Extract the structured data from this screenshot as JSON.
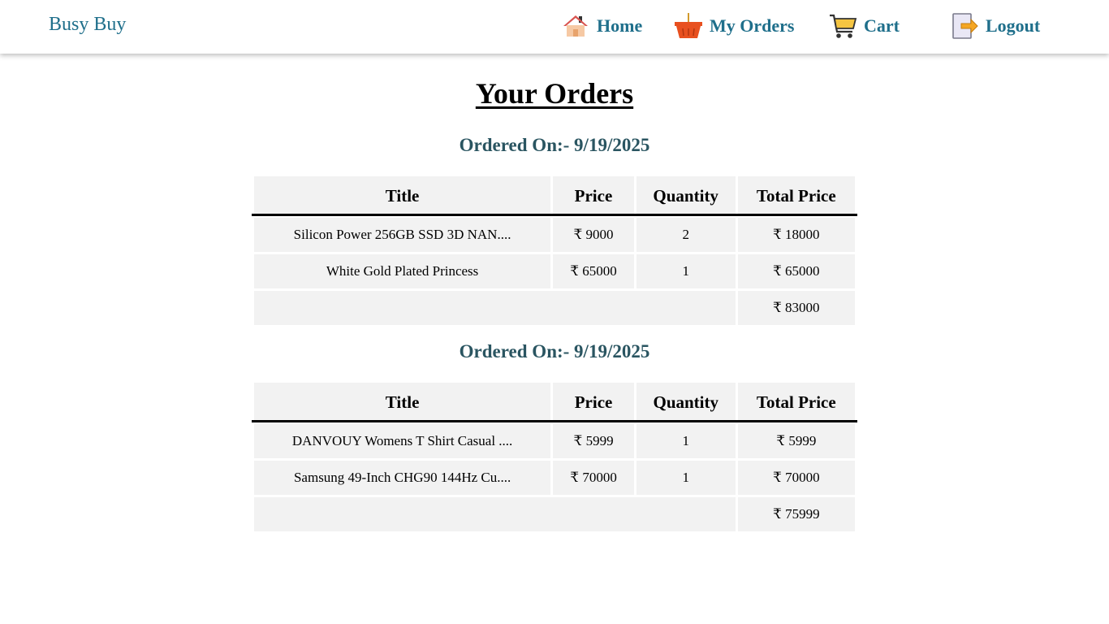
{
  "brand": "Busy Buy",
  "nav": {
    "home": {
      "label": "Home",
      "icon": "home-icon"
    },
    "orders": {
      "label": "My Orders",
      "icon": "basket-icon"
    },
    "cart": {
      "label": "Cart",
      "icon": "cart-icon"
    },
    "logout": {
      "label": "Logout",
      "icon": "logout-icon"
    }
  },
  "page_title": "Your Orders",
  "columns": {
    "title": "Title",
    "price": "Price",
    "quantity": "Quantity",
    "total": "Total Price"
  },
  "orders": [
    {
      "date_label": "Ordered On:- 9/19/2025",
      "items": [
        {
          "title": "Silicon Power 256GB SSD 3D NAN....",
          "price": "₹ 9000",
          "quantity": "2",
          "total": "₹ 18000"
        },
        {
          "title": "White Gold Plated Princess",
          "price": "₹ 65000",
          "quantity": "1",
          "total": "₹ 65000"
        }
      ],
      "grand_total": "₹ 83000"
    },
    {
      "date_label": "Ordered On:- 9/19/2025",
      "items": [
        {
          "title": "DANVOUY Womens T Shirt Casual ....",
          "price": "₹ 5999",
          "quantity": "1",
          "total": "₹ 5999"
        },
        {
          "title": "Samsung 49-Inch CHG90 144Hz Cu....",
          "price": "₹ 70000",
          "quantity": "1",
          "total": "₹ 70000"
        }
      ],
      "grand_total": "₹ 75999"
    }
  ],
  "colors": {
    "link": "#1f6f8b",
    "order_date": "#2a5561",
    "cell_bg": "#f2f2f2"
  }
}
